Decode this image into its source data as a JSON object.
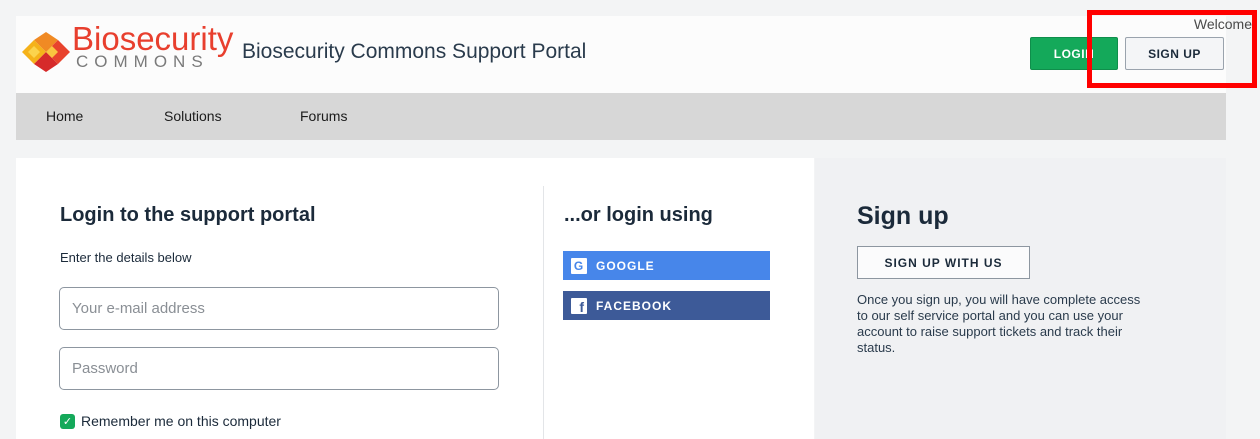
{
  "header": {
    "welcome": "Welcome",
    "logo_bio": "Bio",
    "logo_security": "security",
    "logo_commons": "COMMONS",
    "portal_title": "Biosecurity Commons Support Portal",
    "login_button": "LOGIN",
    "signup_button": "SIGN UP"
  },
  "nav": {
    "items": [
      {
        "label": "Home"
      },
      {
        "label": "Solutions"
      },
      {
        "label": "Forums"
      }
    ]
  },
  "login": {
    "heading": "Login to the support portal",
    "subheading": "Enter the details below",
    "email_placeholder": "Your e-mail address",
    "password_placeholder": "Password",
    "remember_label": "Remember me on this computer"
  },
  "social": {
    "heading": "...or login using",
    "google_label": "GOOGLE",
    "google_icon": "G",
    "facebook_label": "FACEBOOK",
    "facebook_icon": "f"
  },
  "signup": {
    "heading": "Sign up",
    "button": "SIGN UP WITH US",
    "description": "Once you sign up, you will have complete access to our self service portal and you can use your account to raise support tickets and track their status."
  },
  "colors": {
    "accent_green": "#14a95a",
    "google_blue": "#4786ea",
    "facebook_blue": "#3d5a98",
    "brand_red": "#e83f2e",
    "highlight_red": "#ff0000"
  }
}
